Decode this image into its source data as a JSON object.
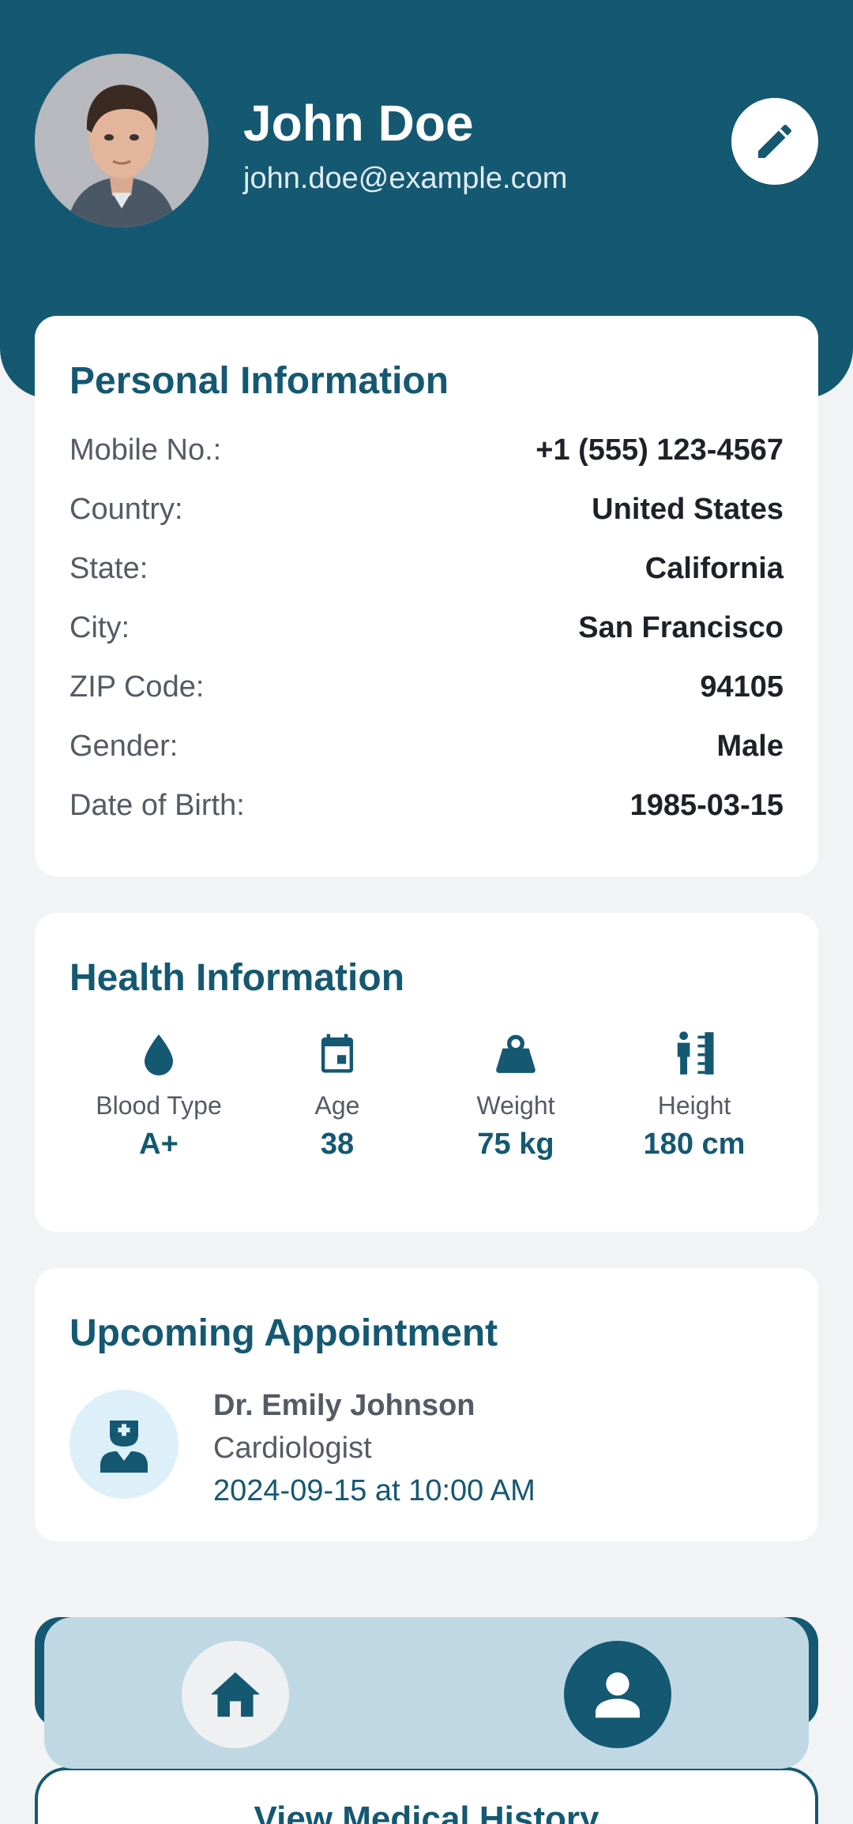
{
  "profile": {
    "name": "John Doe",
    "email": "john.doe@example.com",
    "avatar_icon": "user-photo",
    "edit_icon": "pencil-icon"
  },
  "personal": {
    "title": "Personal Information",
    "rows": [
      {
        "label": "Mobile No.:",
        "value": "+1 (555) 123-4567"
      },
      {
        "label": "Country:",
        "value": "United States"
      },
      {
        "label": "State:",
        "value": "California"
      },
      {
        "label": "City:",
        "value": "San Francisco"
      },
      {
        "label": "ZIP Code:",
        "value": "94105"
      },
      {
        "label": "Gender:",
        "value": "Male"
      },
      {
        "label": "Date of Birth:",
        "value": "1985-03-15"
      }
    ]
  },
  "health": {
    "title": "Health Information",
    "metrics": [
      {
        "icon": "drop-icon",
        "label": "Blood Type",
        "value": "A+"
      },
      {
        "icon": "calendar-icon",
        "label": "Age",
        "value": "38"
      },
      {
        "icon": "weight-icon",
        "label": "Weight",
        "value": "75 kg"
      },
      {
        "icon": "height-icon",
        "label": "Height",
        "value": "180 cm"
      }
    ]
  },
  "appointment": {
    "title": "Upcoming Appointment",
    "doctor_icon": "doctor-icon",
    "doctor": "Dr. Emily Johnson",
    "specialty": "Cardiologist",
    "when": "2024-09-15 at 10:00 AM"
  },
  "actions": {
    "history_label": "View Medical History"
  },
  "nav": {
    "items": [
      {
        "icon": "home-icon",
        "active": false
      },
      {
        "icon": "person-icon",
        "active": true
      }
    ]
  },
  "colors": {
    "primary": "#145872",
    "background": "#f2f3f5",
    "card": "#ffffff",
    "nav_bar": "#c0d8e4",
    "doctor_avatar_bg": "#ddf0fa"
  }
}
